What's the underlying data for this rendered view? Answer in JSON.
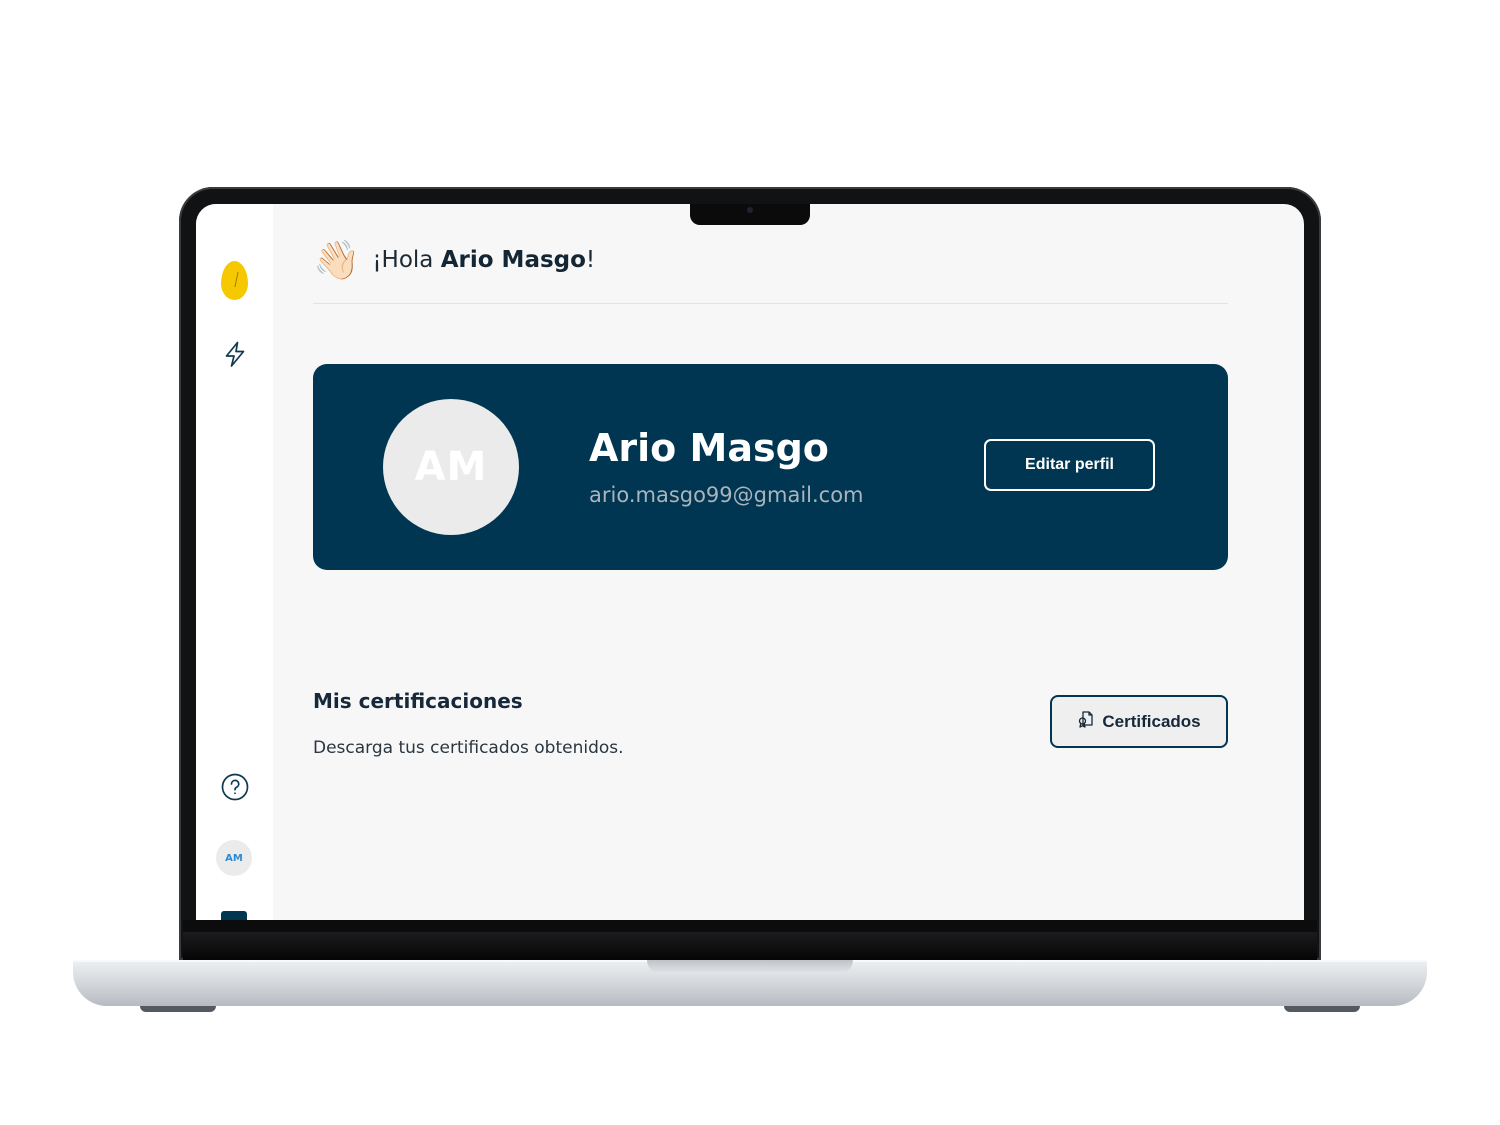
{
  "greeting": {
    "emoji": "👋🏻",
    "prefix": "¡Hola ",
    "name": "Ario Masgo",
    "suffix": "!"
  },
  "sidebar": {
    "logo": "egg-logo-icon",
    "items": [
      {
        "icon": "lightning-icon"
      },
      {
        "icon": "help-circle-icon"
      }
    ],
    "avatar_initials": "AM"
  },
  "profile": {
    "initials": "AM",
    "name": "Ario Masgo",
    "email": "ario.masgo99@gmail.com",
    "edit_label": "Editar perfil"
  },
  "certifications": {
    "title": "Mis certificaciones",
    "subtitle": "Descarga tus certificados obtenidos.",
    "button_label": "Certificados",
    "button_icon": "certificate-icon"
  },
  "colors": {
    "primary": "#003651",
    "accent_yellow": "#f5c800",
    "page_bg": "#f7f7f7",
    "avatar_text_blue": "#2b8ad8"
  }
}
